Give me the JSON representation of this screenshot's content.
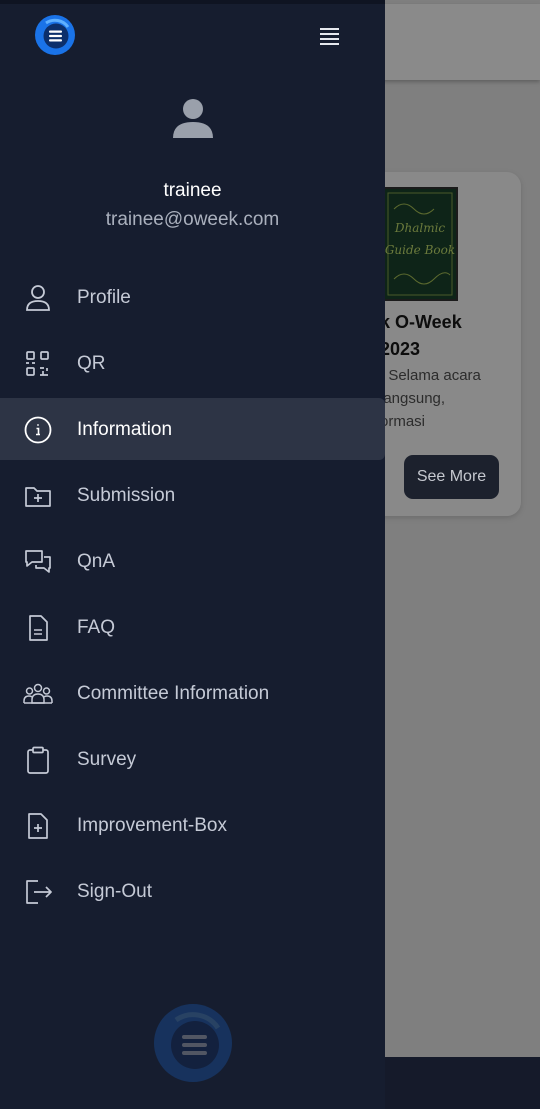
{
  "background": {
    "card": {
      "book_text": "Dhalmic\nGuide Book",
      "title": "k O-Week\n2023",
      "description": "! Selama acara\nlangsung,\normasi",
      "see_more_label": "See More"
    }
  },
  "drawer": {
    "logo_icon": "app-logo-icon",
    "menu_toggle_icon": "hamburger-icon",
    "user": {
      "avatar_icon": "user-avatar-icon",
      "name": "trainee",
      "email": "trainee@oweek.com"
    },
    "menu_items": [
      {
        "label": "Profile",
        "icon": "person-icon"
      },
      {
        "label": "QR",
        "icon": "qr-icon"
      },
      {
        "label": "Information",
        "icon": "info-icon",
        "active": true
      },
      {
        "label": "Submission",
        "icon": "folder-plus-icon"
      },
      {
        "label": "QnA",
        "icon": "chat-bubbles-icon"
      },
      {
        "label": "FAQ",
        "icon": "document-icon"
      },
      {
        "label": "Committee Information",
        "icon": "people-group-icon"
      },
      {
        "label": "Survey",
        "icon": "clipboard-icon"
      },
      {
        "label": "Improvement-Box",
        "icon": "file-plus-icon"
      },
      {
        "label": "Sign-Out",
        "icon": "sign-out-icon"
      }
    ]
  },
  "colors": {
    "drawer_bg": "#161d2f",
    "active_item_bg": "#2d3445",
    "logo_blue": "#1a73e8"
  }
}
